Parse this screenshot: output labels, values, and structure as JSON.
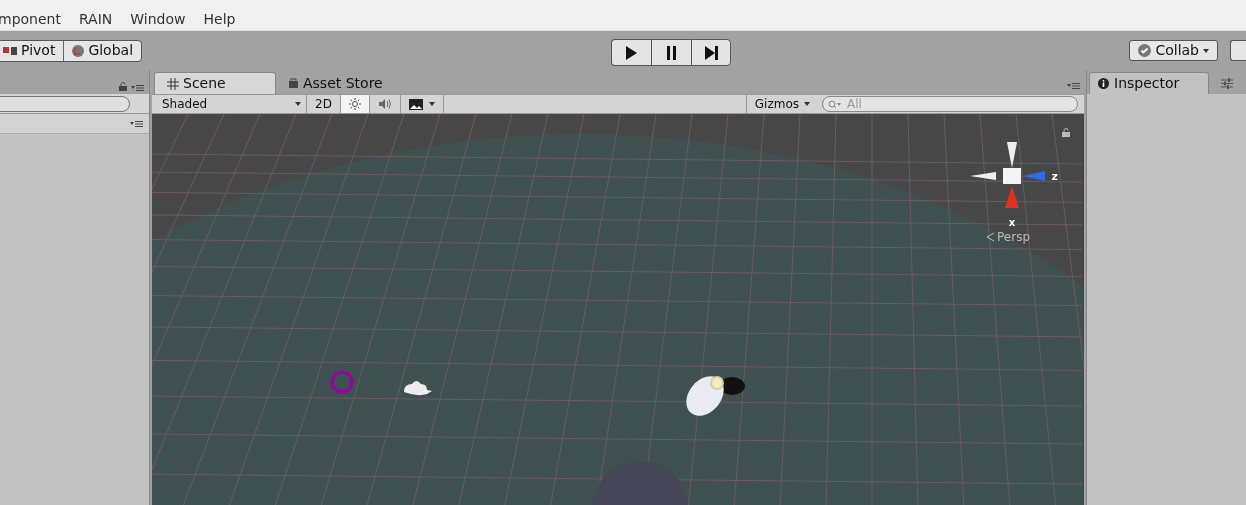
{
  "menu": [
    "mponent",
    "RAIN",
    "Window",
    "Help"
  ],
  "toolbar": {
    "pivot": "Pivot",
    "global": "Global",
    "play": {
      "on": false
    },
    "pause": {
      "on": false
    },
    "collab": "Collab"
  },
  "scene_tabs": [
    {
      "label": "Scene",
      "selected": true,
      "kind": "grid"
    },
    {
      "label": "Asset Store",
      "selected": false,
      "kind": "store"
    }
  ],
  "scene_toolbar": {
    "shading": "Shaded",
    "toggles": [
      {
        "label": "2D",
        "kind": "text",
        "on": false
      },
      {
        "kind": "light",
        "on": true
      },
      {
        "kind": "audio",
        "on": false
      }
    ],
    "gizmos": "Gizmos",
    "search_placeholder": "All"
  },
  "gizmo": {
    "x_label": "x",
    "z_label": "z",
    "projection": "Persp"
  },
  "right_tabs": [
    {
      "label": "Inspector",
      "selected": true,
      "kind": "info"
    },
    {
      "selected": false,
      "kind": "layers"
    }
  ]
}
